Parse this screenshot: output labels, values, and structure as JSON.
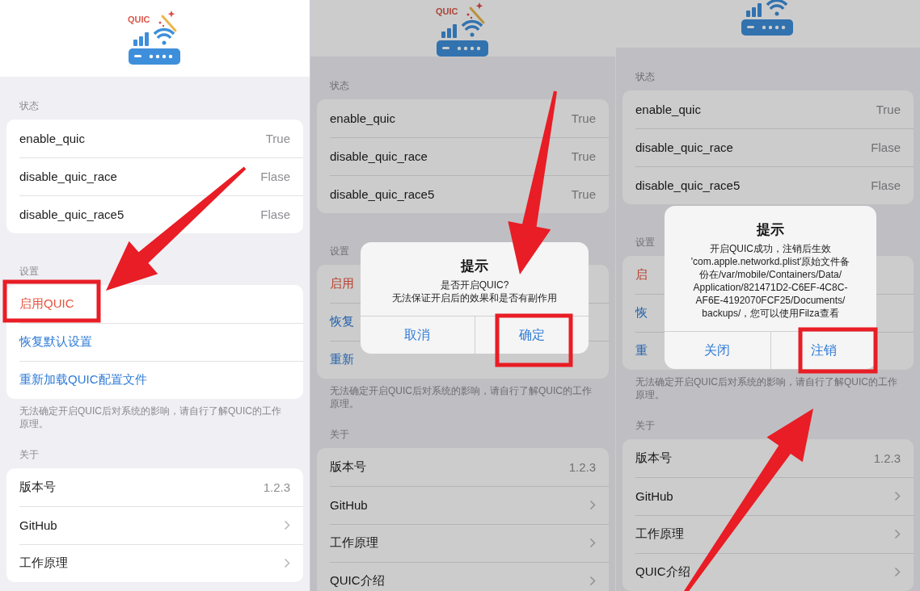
{
  "panels": [
    {
      "logo_text": "QUIC",
      "sections": [
        {
          "header": "状态",
          "rows": [
            {
              "kind": "value",
              "label": "enable_quic",
              "value": "True"
            },
            {
              "kind": "value",
              "label": "disable_quic_race",
              "value": "Flase"
            },
            {
              "kind": "value",
              "label": "disable_quic_race5",
              "value": "Flase"
            }
          ]
        },
        {
          "header": "设置",
          "rows": [
            {
              "kind": "destructive",
              "label": "启用QUIC"
            },
            {
              "kind": "link",
              "label": "恢复默认设置"
            },
            {
              "kind": "link",
              "label": "重新加载QUIC配置文件"
            }
          ],
          "footer": "无法确定开启QUIC后对系统的影响，请自行了解QUIC的工作原理。"
        },
        {
          "header": "关于",
          "rows": [
            {
              "kind": "value",
              "label": "版本号",
              "value": "1.2.3"
            },
            {
              "kind": "disclosure",
              "label": "GitHub"
            },
            {
              "kind": "disclosure",
              "label": "工作原理"
            }
          ]
        }
      ]
    },
    {
      "logo_text": "QUIC",
      "sections": [
        {
          "header": "状态",
          "rows": [
            {
              "kind": "value",
              "label": "enable_quic",
              "value": "True"
            },
            {
              "kind": "value",
              "label": "disable_quic_race",
              "value": "True"
            },
            {
              "kind": "value",
              "label": "disable_quic_race5",
              "value": "True"
            }
          ]
        },
        {
          "header": "设置",
          "rows": [
            {
              "kind": "destructive",
              "label": "启用"
            },
            {
              "kind": "link",
              "label": "恢复"
            },
            {
              "kind": "link",
              "label": "重新"
            }
          ],
          "footer": "无法确定开启QUIC后对系统的影响，请自行了解QUIC的工作原理。"
        },
        {
          "header": "关于",
          "rows": [
            {
              "kind": "value",
              "label": "版本号",
              "value": "1.2.3"
            },
            {
              "kind": "disclosure",
              "label": "GitHub"
            },
            {
              "kind": "disclosure",
              "label": "工作原理"
            },
            {
              "kind": "disclosure",
              "label": "QUIC介绍"
            }
          ]
        }
      ],
      "dialog": {
        "title": "提示",
        "message_lines": [
          "是否开启QUIC?",
          "无法保证开启后的效果和是否有副作用"
        ],
        "buttons": [
          "取消",
          "确定"
        ]
      }
    },
    {
      "sections": [
        {
          "header": "状态",
          "rows": [
            {
              "kind": "value",
              "label": "enable_quic",
              "value": "True"
            },
            {
              "kind": "value",
              "label": "disable_quic_race",
              "value": "Flase"
            },
            {
              "kind": "value",
              "label": "disable_quic_race5",
              "value": "Flase"
            }
          ]
        },
        {
          "header": "设置",
          "rows": [
            {
              "kind": "destructive",
              "label": "启"
            },
            {
              "kind": "link",
              "label": "恢"
            },
            {
              "kind": "link",
              "label": "重"
            }
          ],
          "footer": "无法确定开启QUIC后对系统的影响，请自行了解QUIC的工作原理。"
        },
        {
          "header": "关于",
          "rows": [
            {
              "kind": "value",
              "label": "版本号",
              "value": "1.2.3"
            },
            {
              "kind": "disclosure",
              "label": "GitHub"
            },
            {
              "kind": "disclosure",
              "label": "工作原理"
            },
            {
              "kind": "disclosure",
              "label": "QUIC介绍"
            }
          ]
        }
      ],
      "dialog": {
        "title": "提示",
        "message_lines": [
          "开启QUIC成功，注销后生效",
          "'com.apple.networkd.plist'原始文件备",
          "份在/var/mobile/Containers/Data/",
          "Application/821471D2-C6EF-4C8C-",
          "AF6E-4192070FCF25/Documents/",
          "backups/，您可以使用Filza查看"
        ],
        "buttons": [
          "关闭",
          "注销"
        ]
      }
    }
  ]
}
